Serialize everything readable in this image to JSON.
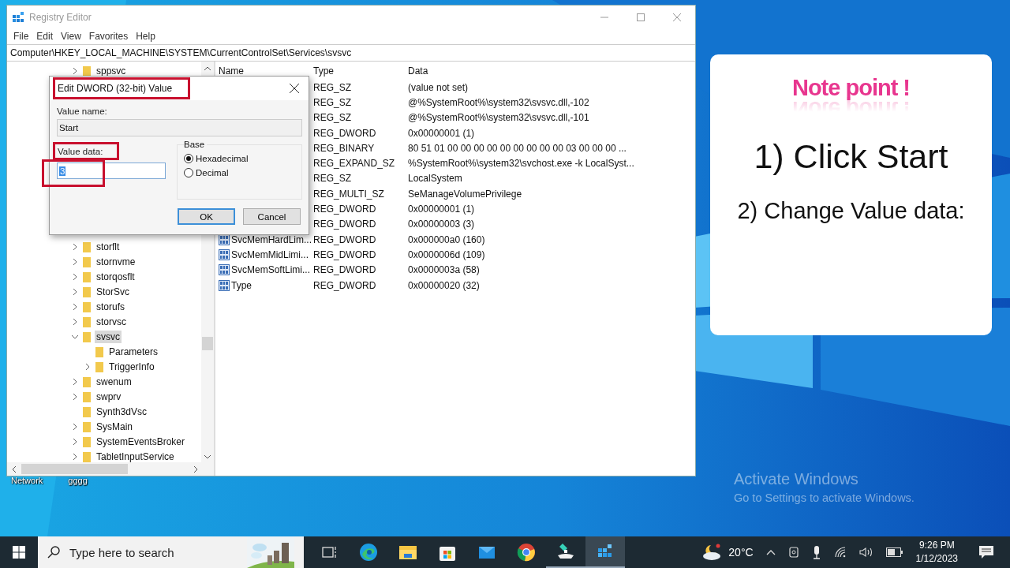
{
  "desktop": {
    "icons": [
      {
        "label": "Network"
      },
      {
        "label": "gggg"
      }
    ],
    "activation": {
      "title": "Activate Windows",
      "subtitle": "Go to Settings to activate Windows."
    }
  },
  "window": {
    "title": "Registry Editor",
    "menu": [
      "File",
      "Edit",
      "View",
      "Favorites",
      "Help"
    ],
    "address": "Computer\\HKEY_LOCAL_MACHINE\\SYSTEM\\CurrentControlSet\\Services\\svsvc",
    "tree": {
      "top": [
        {
          "label": "sppsvc",
          "has_children": true,
          "expanded": false,
          "selected": false
        }
      ],
      "items": [
        {
          "label": "storflt",
          "has_children": true,
          "expanded": false,
          "selected": false
        },
        {
          "label": "stornvme",
          "has_children": true,
          "expanded": false,
          "selected": false
        },
        {
          "label": "storqosflt",
          "has_children": true,
          "expanded": false,
          "selected": false
        },
        {
          "label": "StorSvc",
          "has_children": true,
          "expanded": false,
          "selected": false
        },
        {
          "label": "storufs",
          "has_children": true,
          "expanded": false,
          "selected": false
        },
        {
          "label": "storvsc",
          "has_children": true,
          "expanded": false,
          "selected": false
        },
        {
          "label": "svsvc",
          "has_children": true,
          "expanded": true,
          "selected": true,
          "children": [
            {
              "label": "Parameters",
              "has_children": false,
              "selected": false
            },
            {
              "label": "TriggerInfo",
              "has_children": true,
              "expanded": false,
              "selected": false
            }
          ]
        },
        {
          "label": "swenum",
          "has_children": true,
          "expanded": false,
          "selected": false
        },
        {
          "label": "swprv",
          "has_children": true,
          "expanded": false,
          "selected": false
        },
        {
          "label": "Synth3dVsc",
          "has_children": false,
          "selected": false
        },
        {
          "label": "SysMain",
          "has_children": true,
          "expanded": false,
          "selected": false
        },
        {
          "label": "SystemEventsBroker",
          "has_children": true,
          "expanded": false,
          "selected": false
        },
        {
          "label": "TabletInputService",
          "has_children": true,
          "expanded": false,
          "selected": false
        }
      ]
    },
    "list": {
      "columns": [
        "Name",
        "Type",
        "Data"
      ],
      "rows": [
        {
          "type": "REG_SZ",
          "data": "(value not set)"
        },
        {
          "type": "REG_SZ",
          "data": "@%SystemRoot%\\system32\\svsvc.dll,-102"
        },
        {
          "type": "REG_SZ",
          "data": "@%SystemRoot%\\system32\\svsvc.dll,-101"
        },
        {
          "type": "REG_DWORD",
          "data": "0x00000001 (1)"
        },
        {
          "type": "REG_BINARY",
          "data": "80 51 01 00 00 00 00 00 00 00 00 00 03 00 00 00 ..."
        },
        {
          "type": "REG_EXPAND_SZ",
          "data": "%SystemRoot%\\system32\\svchost.exe -k LocalSyst..."
        },
        {
          "type": "REG_SZ",
          "data": "LocalSystem"
        },
        {
          "type": "REG_MULTI_SZ",
          "data": "SeManageVolumePrivilege"
        },
        {
          "type": "REG_DWORD",
          "data": "0x00000001 (1)"
        },
        {
          "type": "REG_DWORD",
          "data": "0x00000003 (3)"
        },
        {
          "name": "SvcMemHardLim...",
          "kind": "binary",
          "type": "REG_DWORD",
          "data": "0x000000a0 (160)"
        },
        {
          "name": "SvcMemMidLimi...",
          "kind": "binary",
          "type": "REG_DWORD",
          "data": "0x0000006d (109)"
        },
        {
          "name": "SvcMemSoftLimi...",
          "kind": "binary",
          "type": "REG_DWORD",
          "data": "0x0000003a (58)"
        },
        {
          "name": "Type",
          "kind": "binary",
          "type": "REG_DWORD",
          "data": "0x00000020 (32)"
        }
      ]
    }
  },
  "dialog": {
    "title": "Edit DWORD (32-bit) Value",
    "title_highlighted": true,
    "value_name": {
      "label": "Value name:",
      "value": "Start"
    },
    "value_data": {
      "label": "Value data:",
      "value": "3",
      "text_selected": true,
      "label_highlighted": true,
      "field_highlighted": true
    },
    "base": {
      "label": "Base",
      "options": [
        {
          "label": "Hexadecimal",
          "selected": true
        },
        {
          "label": "Decimal",
          "selected": false
        }
      ]
    },
    "buttons": [
      {
        "label": "OK",
        "default": true
      },
      {
        "label": "Cancel",
        "default": false
      }
    ]
  },
  "note": {
    "title": "Note point !",
    "steps": [
      "1) Click Start",
      "2) Change Value data:"
    ]
  },
  "taskbar": {
    "search": {
      "placeholder": "Type here to search"
    },
    "apps": [
      {
        "kind": "taskview",
        "running": false,
        "active": false
      },
      {
        "kind": "edge",
        "running": false,
        "active": false
      },
      {
        "kind": "explorer",
        "running": false,
        "active": false
      },
      {
        "kind": "store",
        "running": false,
        "active": false
      },
      {
        "kind": "mail",
        "running": false,
        "active": false
      },
      {
        "kind": "chrome",
        "running": false,
        "active": false
      },
      {
        "kind": "editor",
        "running": true,
        "active": false
      },
      {
        "kind": "regedit",
        "running": true,
        "active": true
      }
    ],
    "temperature": "20°C",
    "time": "9:26 PM",
    "date": "1/12/2023"
  }
}
